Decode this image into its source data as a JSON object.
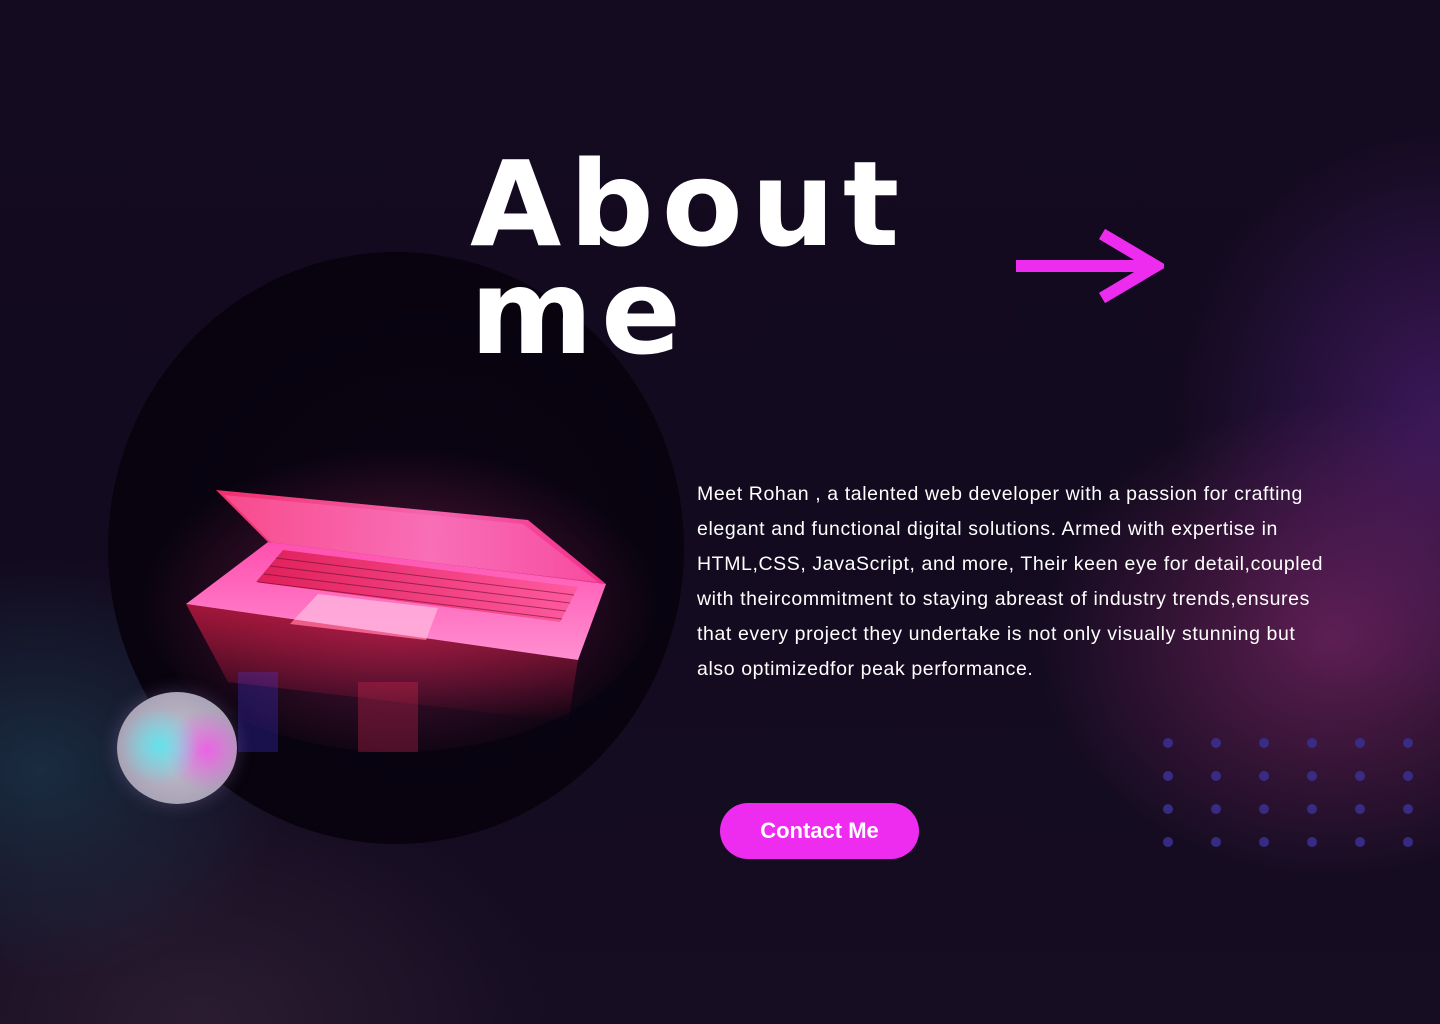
{
  "hero": {
    "title_line1": "About",
    "title_line2": "me",
    "bio": "Meet Rohan , a talented web developer with a passion for crafting\nelegant and functional digital solutions. Armed with expertise in\nHTML,CSS, JavaScript, and more, Their keen eye for detail,coupled\nwith theircommitment to staying abreast of industry trends,ensures\nthat every project they undertake is not only visually stunning but\n also optimizedfor peak performance.",
    "contact_label": "Contact Me"
  },
  "icons": {
    "arrow": "arrow-right-icon",
    "orb": "gradient-orb",
    "laptop": "laptop-image",
    "dots": "dot-grid-decoration"
  },
  "colors": {
    "accent": "#ee2cf0",
    "arrow": "#ee2cf0",
    "background": "#140b20",
    "text": "#ffffff",
    "dots": "#3a2f8e"
  }
}
